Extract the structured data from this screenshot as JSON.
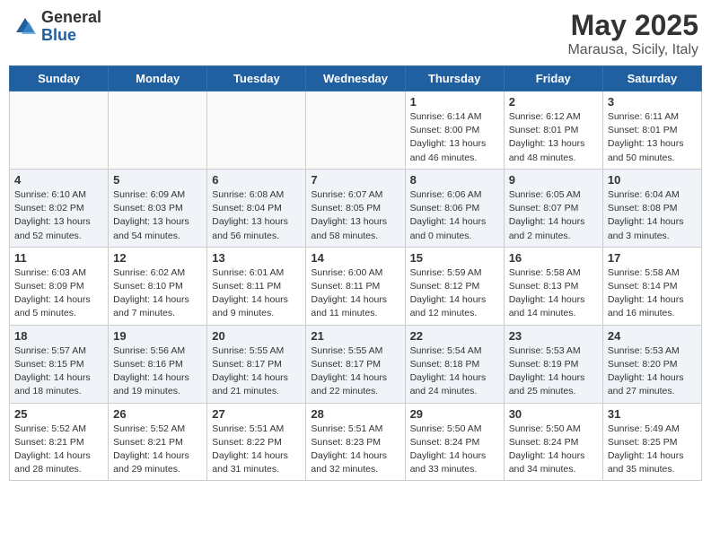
{
  "header": {
    "logo_general": "General",
    "logo_blue": "Blue",
    "month": "May 2025",
    "location": "Marausa, Sicily, Italy"
  },
  "days_of_week": [
    "Sunday",
    "Monday",
    "Tuesday",
    "Wednesday",
    "Thursday",
    "Friday",
    "Saturday"
  ],
  "weeks": [
    [
      {
        "day": "",
        "info": ""
      },
      {
        "day": "",
        "info": ""
      },
      {
        "day": "",
        "info": ""
      },
      {
        "day": "",
        "info": ""
      },
      {
        "day": "1",
        "info": "Sunrise: 6:14 AM\nSunset: 8:00 PM\nDaylight: 13 hours\nand 46 minutes."
      },
      {
        "day": "2",
        "info": "Sunrise: 6:12 AM\nSunset: 8:01 PM\nDaylight: 13 hours\nand 48 minutes."
      },
      {
        "day": "3",
        "info": "Sunrise: 6:11 AM\nSunset: 8:01 PM\nDaylight: 13 hours\nand 50 minutes."
      }
    ],
    [
      {
        "day": "4",
        "info": "Sunrise: 6:10 AM\nSunset: 8:02 PM\nDaylight: 13 hours\nand 52 minutes."
      },
      {
        "day": "5",
        "info": "Sunrise: 6:09 AM\nSunset: 8:03 PM\nDaylight: 13 hours\nand 54 minutes."
      },
      {
        "day": "6",
        "info": "Sunrise: 6:08 AM\nSunset: 8:04 PM\nDaylight: 13 hours\nand 56 minutes."
      },
      {
        "day": "7",
        "info": "Sunrise: 6:07 AM\nSunset: 8:05 PM\nDaylight: 13 hours\nand 58 minutes."
      },
      {
        "day": "8",
        "info": "Sunrise: 6:06 AM\nSunset: 8:06 PM\nDaylight: 14 hours\nand 0 minutes."
      },
      {
        "day": "9",
        "info": "Sunrise: 6:05 AM\nSunset: 8:07 PM\nDaylight: 14 hours\nand 2 minutes."
      },
      {
        "day": "10",
        "info": "Sunrise: 6:04 AM\nSunset: 8:08 PM\nDaylight: 14 hours\nand 3 minutes."
      }
    ],
    [
      {
        "day": "11",
        "info": "Sunrise: 6:03 AM\nSunset: 8:09 PM\nDaylight: 14 hours\nand 5 minutes."
      },
      {
        "day": "12",
        "info": "Sunrise: 6:02 AM\nSunset: 8:10 PM\nDaylight: 14 hours\nand 7 minutes."
      },
      {
        "day": "13",
        "info": "Sunrise: 6:01 AM\nSunset: 8:11 PM\nDaylight: 14 hours\nand 9 minutes."
      },
      {
        "day": "14",
        "info": "Sunrise: 6:00 AM\nSunset: 8:11 PM\nDaylight: 14 hours\nand 11 minutes."
      },
      {
        "day": "15",
        "info": "Sunrise: 5:59 AM\nSunset: 8:12 PM\nDaylight: 14 hours\nand 12 minutes."
      },
      {
        "day": "16",
        "info": "Sunrise: 5:58 AM\nSunset: 8:13 PM\nDaylight: 14 hours\nand 14 minutes."
      },
      {
        "day": "17",
        "info": "Sunrise: 5:58 AM\nSunset: 8:14 PM\nDaylight: 14 hours\nand 16 minutes."
      }
    ],
    [
      {
        "day": "18",
        "info": "Sunrise: 5:57 AM\nSunset: 8:15 PM\nDaylight: 14 hours\nand 18 minutes."
      },
      {
        "day": "19",
        "info": "Sunrise: 5:56 AM\nSunset: 8:16 PM\nDaylight: 14 hours\nand 19 minutes."
      },
      {
        "day": "20",
        "info": "Sunrise: 5:55 AM\nSunset: 8:17 PM\nDaylight: 14 hours\nand 21 minutes."
      },
      {
        "day": "21",
        "info": "Sunrise: 5:55 AM\nSunset: 8:17 PM\nDaylight: 14 hours\nand 22 minutes."
      },
      {
        "day": "22",
        "info": "Sunrise: 5:54 AM\nSunset: 8:18 PM\nDaylight: 14 hours\nand 24 minutes."
      },
      {
        "day": "23",
        "info": "Sunrise: 5:53 AM\nSunset: 8:19 PM\nDaylight: 14 hours\nand 25 minutes."
      },
      {
        "day": "24",
        "info": "Sunrise: 5:53 AM\nSunset: 8:20 PM\nDaylight: 14 hours\nand 27 minutes."
      }
    ],
    [
      {
        "day": "25",
        "info": "Sunrise: 5:52 AM\nSunset: 8:21 PM\nDaylight: 14 hours\nand 28 minutes."
      },
      {
        "day": "26",
        "info": "Sunrise: 5:52 AM\nSunset: 8:21 PM\nDaylight: 14 hours\nand 29 minutes."
      },
      {
        "day": "27",
        "info": "Sunrise: 5:51 AM\nSunset: 8:22 PM\nDaylight: 14 hours\nand 31 minutes."
      },
      {
        "day": "28",
        "info": "Sunrise: 5:51 AM\nSunset: 8:23 PM\nDaylight: 14 hours\nand 32 minutes."
      },
      {
        "day": "29",
        "info": "Sunrise: 5:50 AM\nSunset: 8:24 PM\nDaylight: 14 hours\nand 33 minutes."
      },
      {
        "day": "30",
        "info": "Sunrise: 5:50 AM\nSunset: 8:24 PM\nDaylight: 14 hours\nand 34 minutes."
      },
      {
        "day": "31",
        "info": "Sunrise: 5:49 AM\nSunset: 8:25 PM\nDaylight: 14 hours\nand 35 minutes."
      }
    ]
  ]
}
